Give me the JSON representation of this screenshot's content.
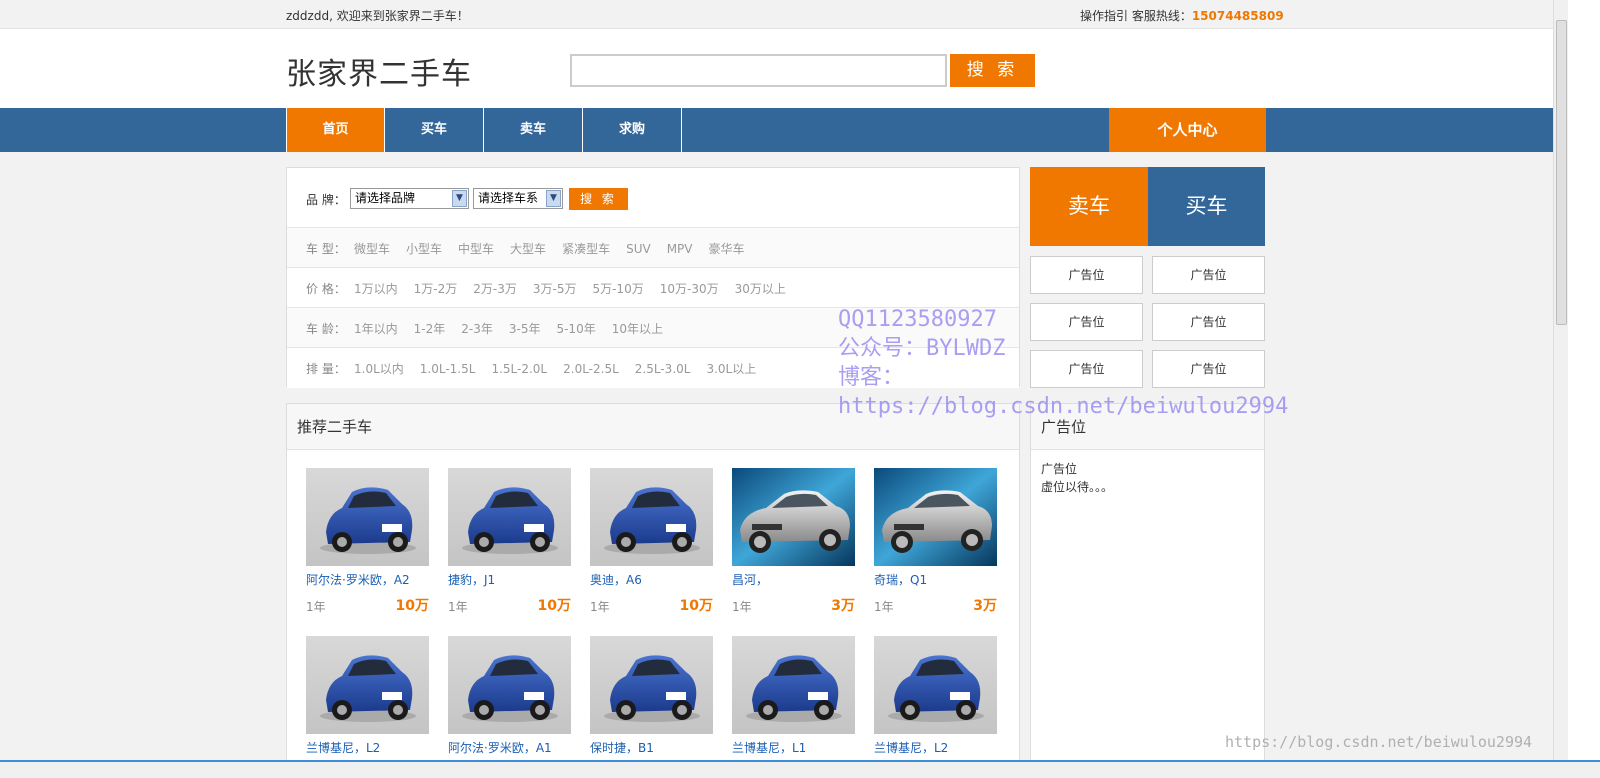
{
  "topbar": {
    "welcome": "zddzdd, 欢迎来到张家界二手车！",
    "guide": "操作指引 客服热线：",
    "hotline": "15074485809"
  },
  "header": {
    "logo": "张家界二手车",
    "search_value": "",
    "search_button": "搜 索"
  },
  "nav": {
    "items": [
      "首页",
      "买车",
      "卖车",
      "求购"
    ],
    "personal": "个人中心"
  },
  "filter": {
    "brand_label": "品 牌：",
    "brand_select": "请选择品牌",
    "series_select": "请选择车系",
    "search_button": "搜 索",
    "rows": [
      {
        "label": "车 型：",
        "options": [
          "微型车",
          "小型车",
          "中型车",
          "大型车",
          "紧凑型车",
          "SUV",
          "MPV",
          "豪华车"
        ]
      },
      {
        "label": "价 格：",
        "options": [
          "1万以内",
          "1万-2万",
          "2万-3万",
          "3万-5万",
          "5万-10万",
          "10万-30万",
          "30万以上"
        ]
      },
      {
        "label": "车 龄：",
        "options": [
          "1年以内",
          "1-2年",
          "2-3年",
          "3-5年",
          "5-10年",
          "10年以上"
        ]
      },
      {
        "label": "排 量：",
        "options": [
          "1.0L以内",
          "1.0L-1.5L",
          "1.5L-2.0L",
          "2.0L-2.5L",
          "2.5L-3.0L",
          "3.0L以上"
        ]
      }
    ]
  },
  "side": {
    "sell": "卖车",
    "buy": "买车",
    "ads": [
      "广告位",
      "广告位",
      "广告位",
      "广告位",
      "广告位",
      "广告位"
    ],
    "box_title": "广告位",
    "box_line1": "广告位",
    "box_line2": "虚位以待。。。"
  },
  "recommend": {
    "title": "推荐二手车",
    "cars": [
      {
        "name": "阿尔法·罗米欧，A2",
        "age": "1年",
        "price": "10万",
        "img": "blue"
      },
      {
        "name": "捷豹，J1",
        "age": "1年",
        "price": "10万",
        "img": "blue"
      },
      {
        "name": "奥迪，A6",
        "age": "1年",
        "price": "10万",
        "img": "blue"
      },
      {
        "name": "昌河，",
        "age": "1年",
        "price": "3万",
        "img": "silver"
      },
      {
        "name": "奇瑞，Q1",
        "age": "1年",
        "price": "3万",
        "img": "silver"
      },
      {
        "name": "兰博基尼，L2",
        "age": "",
        "price": "",
        "img": "blue"
      },
      {
        "name": "阿尔法·罗米欧，A1",
        "age": "",
        "price": "",
        "img": "blue"
      },
      {
        "name": "保时捷，B1",
        "age": "",
        "price": "",
        "img": "blue"
      },
      {
        "name": "兰博基尼，L1",
        "age": "",
        "price": "",
        "img": "blue"
      },
      {
        "name": "兰博基尼，L2",
        "age": "",
        "price": "",
        "img": "blue"
      }
    ]
  },
  "watermark": {
    "line1": "QQ1123580927",
    "line2": "公众号：BYLWDZ",
    "line3": "博客：",
    "line4": "https://blog.csdn.net/beiwulou2994",
    "corner": "https://blog.csdn.net/beiwulou2994"
  },
  "colors": {
    "accent": "#f07800",
    "nav": "#336699",
    "link": "#1a5fb4"
  }
}
